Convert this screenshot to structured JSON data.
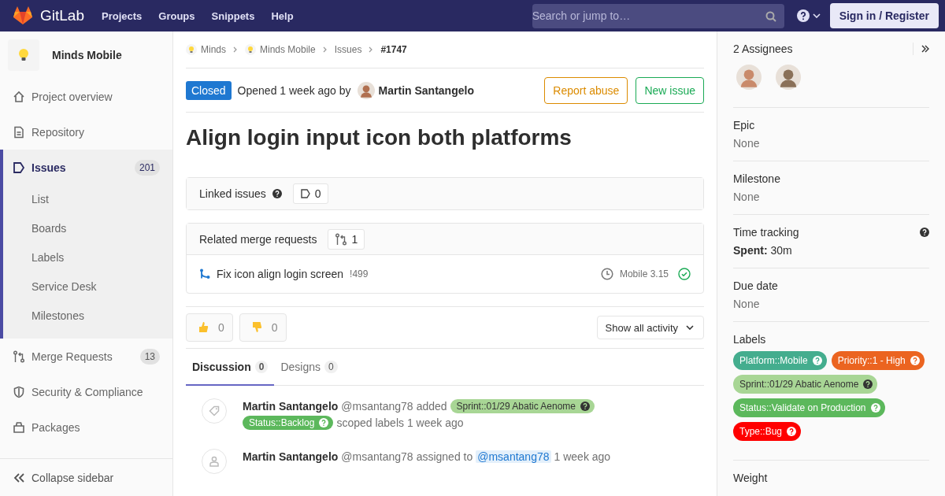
{
  "navbar": {
    "brand": "GitLab",
    "links": [
      "Projects",
      "Groups",
      "Snippets",
      "Help"
    ],
    "search": {
      "placeholder": "Search or jump to…"
    },
    "sign_in": "Sign in / Register"
  },
  "sidebar": {
    "project": "Minds Mobile",
    "items": [
      {
        "label": "Project overview",
        "selected": false
      },
      {
        "label": "Repository",
        "selected": false
      },
      {
        "label": "Issues",
        "count": "201",
        "selected": true,
        "children": [
          {
            "label": "List",
            "selected": false
          },
          {
            "label": "Boards",
            "selected": false
          },
          {
            "label": "Labels",
            "selected": false
          },
          {
            "label": "Service Desk",
            "selected": false
          },
          {
            "label": "Milestones",
            "selected": false
          }
        ]
      },
      {
        "label": "Merge Requests",
        "count": "13",
        "selected": false
      },
      {
        "label": "Security & Compliance",
        "selected": false
      },
      {
        "label": "Packages",
        "selected": false
      }
    ],
    "collapse": "Collapse sidebar"
  },
  "breadcrumb": [
    {
      "label": "Minds",
      "avatar": true
    },
    {
      "label": "Minds Mobile",
      "avatar": true
    },
    {
      "label": "Issues",
      "avatar": false
    },
    {
      "label": "#1747",
      "avatar": false
    }
  ],
  "issue": {
    "status": "Closed",
    "opened": "Opened 1 week ago by",
    "author": "Martin Santangelo",
    "actions": [
      {
        "label": "Report abuse",
        "color": "#db8b00"
      },
      {
        "label": "New issue",
        "color": "#1aaa55"
      }
    ],
    "title": "Align login input icon both platforms"
  },
  "linked_issues": {
    "title": "Linked issues",
    "count": "0"
  },
  "related_mrs": {
    "title": "Related merge requests",
    "count": "1",
    "items": [
      {
        "title": "Fix icon align login screen",
        "ref": "!499",
        "milestone": "Mobile 3.15"
      }
    ]
  },
  "reactions": [
    {
      "kind": "up",
      "count": "0"
    },
    {
      "kind": "down",
      "count": "0"
    }
  ],
  "activity_filter": "Show all activity",
  "tabs": [
    {
      "label": "Discussion",
      "count": "0",
      "selected": true
    },
    {
      "label": "Designs",
      "count": "0",
      "selected": false
    }
  ],
  "notes": [
    {
      "kind": "label",
      "author": "Martin Santangelo",
      "handle": "@msantang78",
      "parts": [
        {
          "kind": "text",
          "text": "added"
        },
        {
          "kind": "label",
          "text": "Sprint::01/29 Abatic Aenome",
          "color": "#a8d695"
        },
        {
          "kind": "label",
          "text": "Status::Backlog",
          "color": "#5cb85c"
        },
        {
          "kind": "text",
          "text": "scoped labels 1 week ago"
        }
      ]
    },
    {
      "kind": "assign",
      "author": "Martin Santangelo",
      "handle": "@msantang78",
      "parts": [
        {
          "kind": "text",
          "text": "assigned to"
        },
        {
          "kind": "mention",
          "text": "@msantang78"
        },
        {
          "kind": "text",
          "text": "1 week ago"
        }
      ]
    }
  ],
  "right_sidebar": {
    "assignees": {
      "title": "2 Assignees"
    },
    "fields": [
      {
        "title": "Epic",
        "value": "None"
      },
      {
        "title": "Milestone",
        "value": "None"
      },
      {
        "title": "Time tracking",
        "strong": "Spent:",
        "value": "30m",
        "help": true
      },
      {
        "title": "Due date",
        "value": "None"
      }
    ],
    "labels": {
      "title": "Labels",
      "items": [
        {
          "text": "Platform::Mobile",
          "color": "#44ad8e"
        },
        {
          "text": "Priority::1 - High",
          "color": "#eb6420"
        },
        {
          "text": "Sprint::01/29 Abatic Aenome",
          "color": "#a8d695"
        },
        {
          "text": "Status::Validate on Production",
          "color": "#5cb85c"
        },
        {
          "text": "Type::Bug",
          "color": "#ff0000"
        }
      ]
    },
    "weight": {
      "title": "Weight"
    }
  }
}
